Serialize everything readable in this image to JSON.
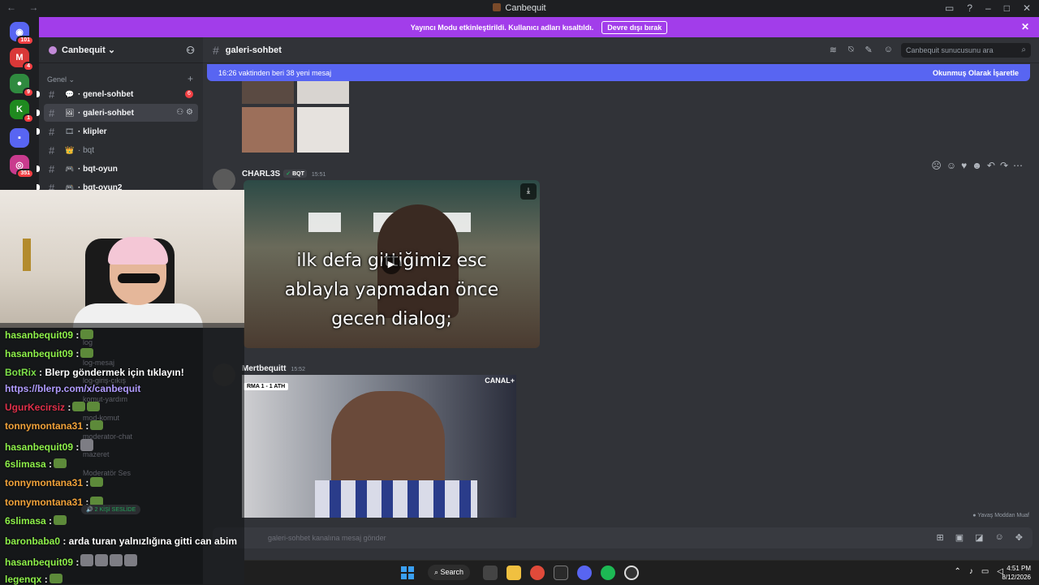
{
  "window": {
    "title": "Canbequit",
    "nav": "← →"
  },
  "servers": [
    {
      "name": "discord-home",
      "badge": "101",
      "color": "#5865f2",
      "glyph": "◉"
    },
    {
      "name": "server-m",
      "badge": "4",
      "color": "#d93838",
      "glyph": "M"
    },
    {
      "name": "server-gray",
      "badge": "9",
      "color": "#2f8a3f",
      "glyph": "●"
    },
    {
      "name": "server-k",
      "badge": "1",
      "color": "#1f8a1f",
      "glyph": "K"
    },
    {
      "name": "server-folder",
      "badge": "",
      "color": "#5865f2",
      "glyph": "▪"
    },
    {
      "name": "server-sub",
      "badge": "351",
      "color": "#c93b8e",
      "glyph": "◎"
    }
  ],
  "banner": {
    "text": "Yayıncı Modu etkinleştirildi. Kullanıcı adları kısaltıldı.",
    "button": "Devre dışı bırak"
  },
  "guild": {
    "name": "Canbequit ⌄"
  },
  "category": {
    "name": "Genel ⌄"
  },
  "channels": [
    {
      "label": "genel-sohbet",
      "emoji": "💬",
      "unread": "6",
      "active": false,
      "bold": true
    },
    {
      "label": "galeri-sohbet",
      "emoji": "🖼",
      "unread": "",
      "active": true,
      "bold": true
    },
    {
      "label": "klipler",
      "emoji": "🎞",
      "unread": "",
      "active": false,
      "bold": true
    },
    {
      "label": "bqt",
      "emoji": "👑",
      "unread": "",
      "active": false,
      "bold": false
    },
    {
      "label": "bqt-oyun",
      "emoji": "🎮",
      "unread": "",
      "active": false,
      "bold": true
    },
    {
      "label": "bqt-oyun2",
      "emoji": "🎮",
      "unread": "",
      "active": false,
      "bold": true
    }
  ],
  "channel_header": {
    "name": "galeri-sohbet",
    "search_placeholder": "Canbequit sunucusunu ara"
  },
  "new_messages": {
    "text": "16:26 vaktinden beri 38 yeni mesaj",
    "mark": "Okunmuş Olarak İşaretle"
  },
  "messages": [
    {
      "author": "CHARL3S",
      "tag": "BQT",
      "time": "15:51",
      "video_caption": "ilk defa gittiğimiz esc\nablayla yapmadan önce\ngecen dialog;"
    },
    {
      "author": "Mertbequitt",
      "time": "15:52",
      "score": "RMA 1 - 1 ATH",
      "channel_logo": "CANAL+"
    }
  ],
  "slow_mode": "Yavaş Moddan Muaf",
  "composer": {
    "placeholder": "galeri-sohbet kanalına mesaj gönder"
  },
  "chat": [
    {
      "user": "hasanbequit09",
      "text": " :",
      "color": "#8ef04a",
      "emotes": 1,
      "cat": false
    },
    {
      "user": "hasanbequit09",
      "text": " :",
      "color": "#8ef04a",
      "emotes": 1,
      "cat": false
    },
    {
      "user": "BotRix",
      "text": " : Blerp göndermek için tıklayın!",
      "color": "#7ee04a",
      "emotes": 0,
      "cat": false
    },
    {
      "user": "",
      "text": "https://blerp.com/x/canbequit",
      "color": "#b19cff",
      "emotes": 0,
      "cat": false
    },
    {
      "user": "UgurKecirsiz",
      "text": " :",
      "color": "#e0304a",
      "emotes": 2,
      "cat": false
    },
    {
      "user": "tonnymontana31",
      "text": " :",
      "color": "#f0a23a",
      "emotes": 1,
      "cat": false
    },
    {
      "user": "hasanbequit09",
      "text": " :",
      "color": "#8ef04a",
      "emotes": 1,
      "cat": true
    },
    {
      "user": "6slimasa",
      "text": " :",
      "color": "#8ef04a",
      "emotes": 1,
      "cat": false
    },
    {
      "user": "tonnymontana31",
      "text": " :",
      "color": "#f0a23a",
      "emotes": 1,
      "cat": false
    },
    {
      "user": "tonnymontana31",
      "text": " :",
      "color": "#f0a23a",
      "emotes": 1,
      "cat": false
    },
    {
      "user": "6slimasa",
      "text": " :",
      "color": "#8ef04a",
      "emotes": 1,
      "cat": false
    },
    {
      "user": "baronbaba0",
      "text": " : arda turan yalnızlığına gitti can abim",
      "color": "#8ef04a",
      "emotes": 0,
      "cat": false
    },
    {
      "user": "hasanbequit09",
      "text": " :",
      "color": "#8ef04a",
      "emotes": 4,
      "cat": true
    },
    {
      "user": "legenqx",
      "text": " :",
      "color": "#8ef04a",
      "emotes": 1,
      "cat": false
    }
  ],
  "ghost_channels": [
    "log",
    "log-mesaj",
    "log-giriş-çıkış",
    "komut-yardım",
    "mod-komut",
    "moderator-chat",
    "mazeret",
    "Moderatör Ses"
  ],
  "voice_badge": "2 KİŞİ SESLİDE",
  "taskbar": {
    "search": "Search",
    "time": "4:51 PM",
    "date": "8/12/2026"
  }
}
